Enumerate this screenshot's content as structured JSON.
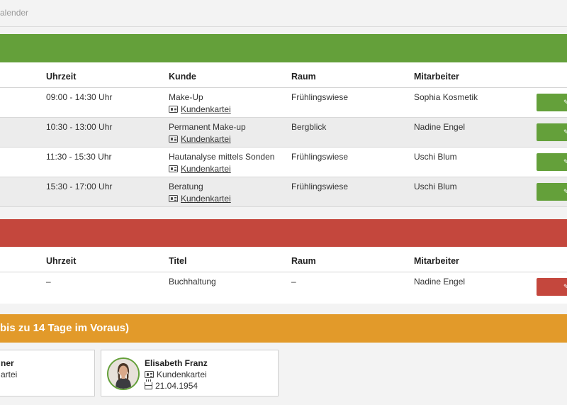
{
  "breadcrumb": "alender",
  "appointments": {
    "section_title": "",
    "columns": [
      "Uhrzeit",
      "Kunde",
      "Raum",
      "Mitarbeiter"
    ],
    "rows": [
      {
        "time": "09:00 - 14:30 Uhr",
        "service": "Make-Up",
        "link": "Kundenkartei",
        "room": "Frühlingswiese",
        "staff": "Sophia Kosmetik"
      },
      {
        "time": "10:30 - 13:00 Uhr",
        "service": "Permanent Make-up",
        "link": "Kundenkartei",
        "room": "Bergblick",
        "staff": "Nadine Engel"
      },
      {
        "time": "11:30 - 15:30 Uhr",
        "service": "Hautanalyse mittels Sonden",
        "link": "Kundenkartei",
        "room": "Frühlingswiese",
        "staff": "Uschi Blum"
      },
      {
        "time": "15:30 - 17:00 Uhr",
        "service": "Beratung",
        "link": "Kundenkartei",
        "room": "Frühlingswiese",
        "staff": "Uschi Blum"
      }
    ]
  },
  "blockers": {
    "section_title": "",
    "columns": [
      "Uhrzeit",
      "Titel",
      "Raum",
      "Mitarbeiter"
    ],
    "rows": [
      {
        "time": "–",
        "title": "Buchhaltung",
        "room": "–",
        "staff": "Nadine Engel"
      }
    ]
  },
  "birthdays": {
    "section_title": "bis zu 14 Tage im Voraus)",
    "cards": [
      {
        "name": "ner",
        "link": "artei"
      },
      {
        "name": "Elisabeth Franz",
        "link": "Kundenkartei",
        "date": "21.04.1954"
      }
    ]
  },
  "colors": {
    "green": "#64a03a",
    "red": "#c4473d",
    "orange": "#e29a2a"
  },
  "icons": {
    "customer_card": "id-card-icon",
    "birthday": "cake-icon",
    "edit": "pencil-icon"
  }
}
